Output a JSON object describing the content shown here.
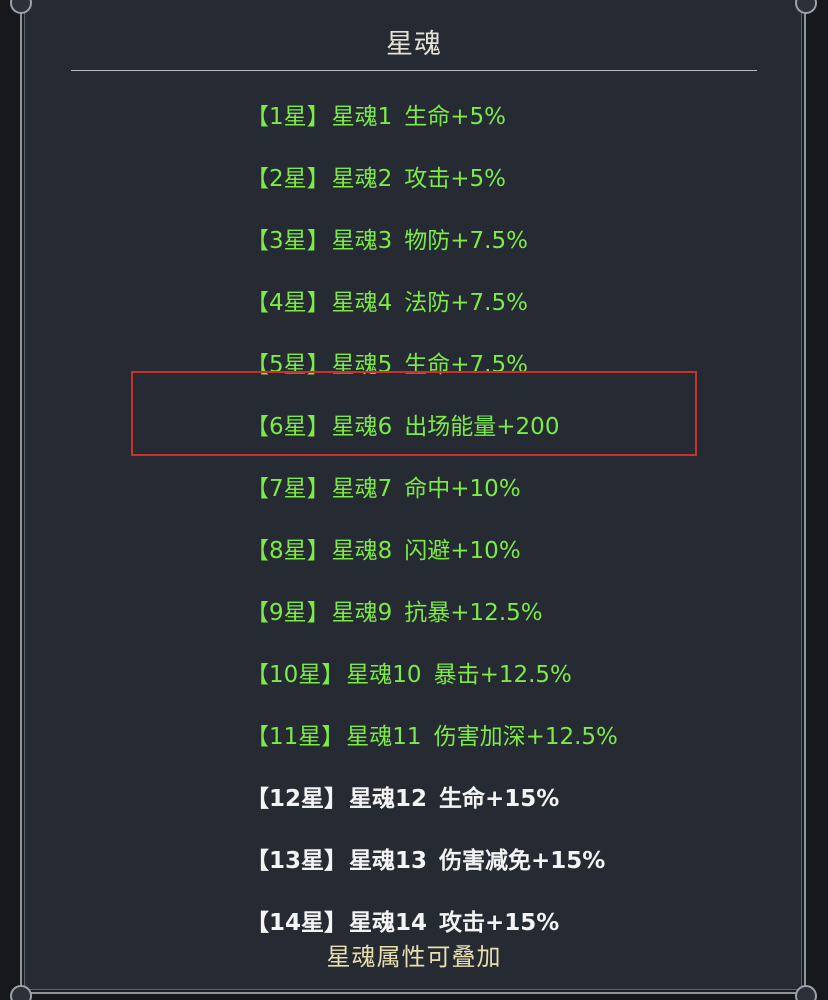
{
  "title": "星魂",
  "rows": [
    {
      "tier": "【1星】",
      "name": "星魂1",
      "effect": "生命+5%"
    },
    {
      "tier": "【2星】",
      "name": "星魂2",
      "effect": "攻击+5%"
    },
    {
      "tier": "【3星】",
      "name": "星魂3",
      "effect": "物防+7.5%"
    },
    {
      "tier": "【4星】",
      "name": "星魂4",
      "effect": "法防+7.5%"
    },
    {
      "tier": "【5星】",
      "name": "星魂5",
      "effect": "生命+7.5%"
    },
    {
      "tier": "【6星】",
      "name": "星魂6",
      "effect": "出场能量+200",
      "highlighted": true
    },
    {
      "tier": "【7星】",
      "name": "星魂7",
      "effect": "命中+10%"
    },
    {
      "tier": "【8星】",
      "name": "星魂8",
      "effect": "闪避+10%"
    },
    {
      "tier": "【9星】",
      "name": "星魂9",
      "effect": "抗暴+12.5%"
    },
    {
      "tier": "【10星】",
      "name": "星魂10",
      "effect": "暴击+12.5%"
    },
    {
      "tier": "【11星】",
      "name": "星魂11",
      "effect": "伤害加深+12.5%"
    },
    {
      "tier": "【12星】",
      "name": "星魂12",
      "effect": "生命+15%"
    },
    {
      "tier": "【13星】",
      "name": "星魂13",
      "effect": "伤害减免+15%"
    },
    {
      "tier": "【14星】",
      "name": "星魂14",
      "effect": "攻击+15%"
    }
  ],
  "footer": "星魂属性可叠加",
  "colors": {
    "panel": "#252a33",
    "green_text": "#7dea45",
    "white_text": "#f3f3f3",
    "highlight_border": "#c9312b",
    "footer_text": "#e9dfae"
  }
}
